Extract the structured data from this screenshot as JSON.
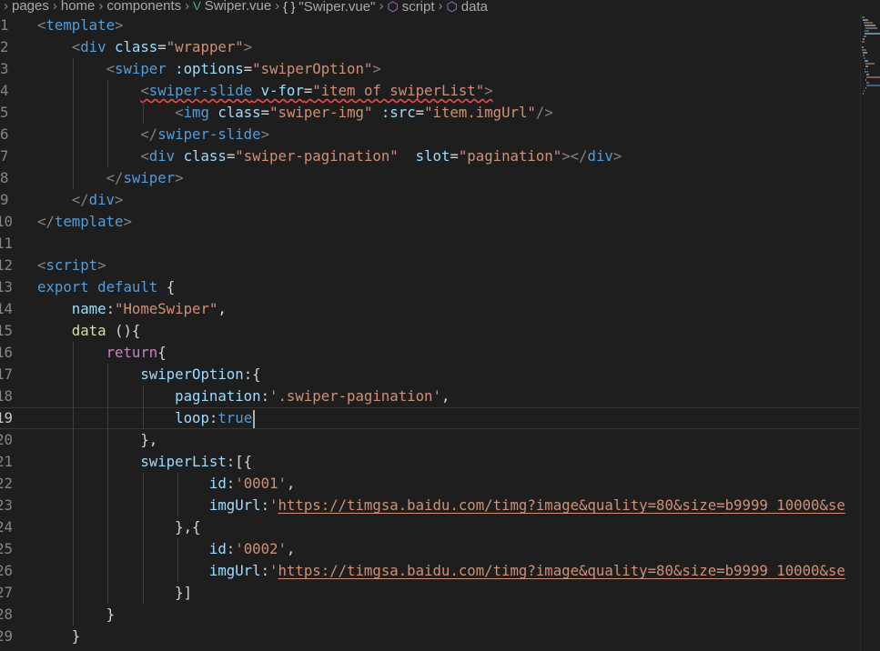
{
  "breadcrumb": {
    "items": [
      "pages",
      "home",
      "components",
      "Swiper.vue",
      "\"Swiper.vue\"",
      "script",
      "data"
    ],
    "icons": {
      "3": "vue-file-icon",
      "4": "braces-icon",
      "5": "cube-icon",
      "6": "cube-icon"
    }
  },
  "editor": {
    "language": "vue",
    "current_line": 19,
    "lines": [
      {
        "num": "1",
        "code": "<template>"
      },
      {
        "num": "2",
        "code": "    <div class=\"wrapper\">"
      },
      {
        "num": "3",
        "code": "        <swiper :options=\"swiperOption\">"
      },
      {
        "num": "4",
        "code": "            <swiper-slide v-for=\"item of swiperList\">"
      },
      {
        "num": "5",
        "code": "                <img class=\"swiper-img\" :src=\"item.imgUrl\"/>"
      },
      {
        "num": "6",
        "code": "            </swiper-slide>"
      },
      {
        "num": "7",
        "code": "            <div class=\"swiper-pagination\"  slot=\"pagination\"></div>"
      },
      {
        "num": "8",
        "code": "        </swiper>"
      },
      {
        "num": "9",
        "code": "    </div>"
      },
      {
        "num": "10",
        "code": "</template>"
      },
      {
        "num": "11",
        "code": ""
      },
      {
        "num": "12",
        "code": "<script>"
      },
      {
        "num": "13",
        "code": "export default {"
      },
      {
        "num": "14",
        "code": "    name:\"HomeSwiper\","
      },
      {
        "num": "15",
        "code": "    data (){"
      },
      {
        "num": "16",
        "code": "        return{"
      },
      {
        "num": "17",
        "code": "            swiperOption:{"
      },
      {
        "num": "18",
        "code": "                pagination:'.swiper-pagination',"
      },
      {
        "num": "19",
        "code": "                loop:true"
      },
      {
        "num": "20",
        "code": "            },"
      },
      {
        "num": "21",
        "code": "            swiperList:[{"
      },
      {
        "num": "22",
        "code": "                    id:'0001',"
      },
      {
        "num": "23",
        "code": "                    imgUrl:'https://timgsa.baidu.com/timg?image&quality=80&size=b9999_10000&se"
      },
      {
        "num": "24",
        "code": "                },{"
      },
      {
        "num": "25",
        "code": "                    id:'0002',"
      },
      {
        "num": "26",
        "code": "                    imgUrl:'https://timgsa.baidu.com/timg?image&quality=80&size=b9999_10000&se"
      },
      {
        "num": "27",
        "code": "                }]"
      },
      {
        "num": "28",
        "code": "        }"
      },
      {
        "num": "29",
        "code": "    }"
      }
    ]
  },
  "colors": {
    "background": "#1e1e1e",
    "tag": "#569cd6",
    "attribute": "#9cdcfe",
    "string": "#ce9178",
    "keyword_control": "#c586c0",
    "function": "#dcdcaa",
    "error_squiggle": "#f14c4c"
  }
}
